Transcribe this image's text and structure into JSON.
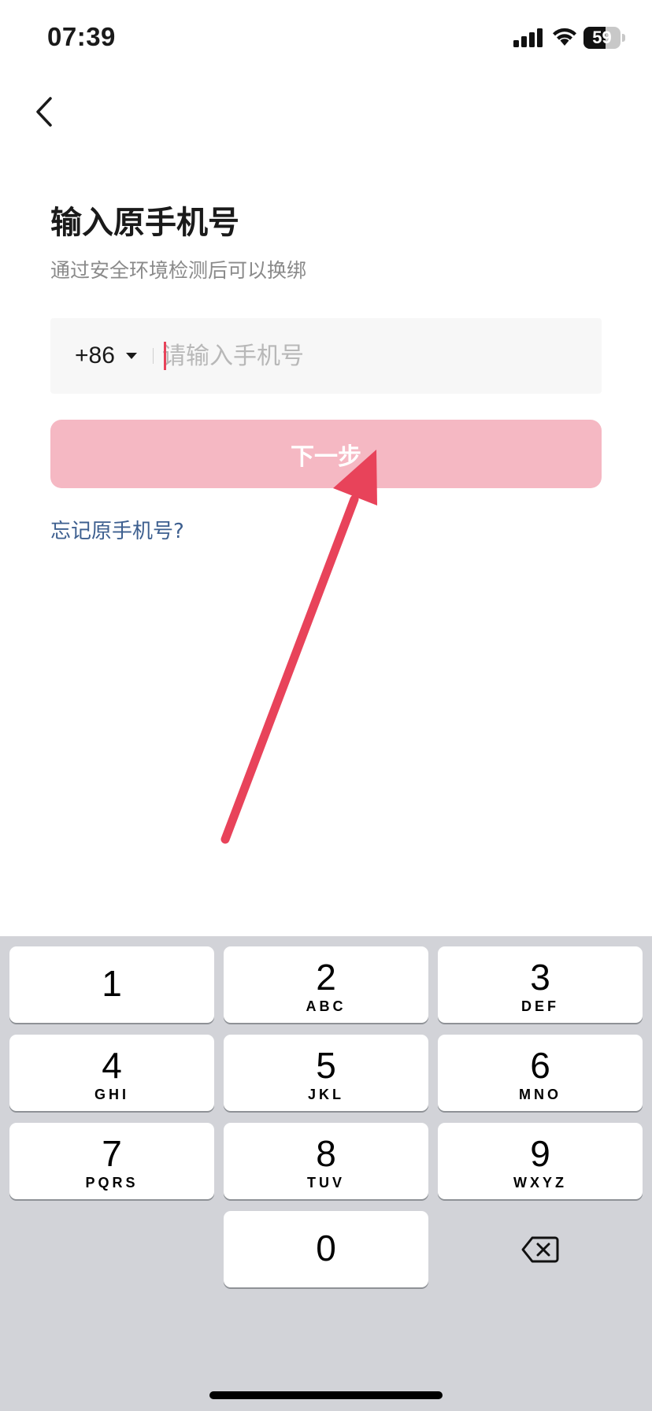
{
  "status_bar": {
    "time": "07:39",
    "battery_level": "59",
    "battery_fraction": 0.59
  },
  "header": {
    "back_icon": "chevron-left-icon"
  },
  "main": {
    "title": "输入原手机号",
    "subtitle": "通过安全环境检测后可以换绑",
    "phone_field": {
      "country_code": "+86",
      "placeholder": "请输入手机号",
      "value": ""
    },
    "next_button_label": "下一步",
    "forgot_link": "忘记原手机号?"
  },
  "keyboard": {
    "keys": [
      {
        "digit": "1",
        "letters": ""
      },
      {
        "digit": "2",
        "letters": "ABC"
      },
      {
        "digit": "3",
        "letters": "DEF"
      },
      {
        "digit": "4",
        "letters": "GHI"
      },
      {
        "digit": "5",
        "letters": "JKL"
      },
      {
        "digit": "6",
        "letters": "MNO"
      },
      {
        "digit": "7",
        "letters": "PQRS"
      },
      {
        "digit": "8",
        "letters": "TUV"
      },
      {
        "digit": "9",
        "letters": "WXYZ"
      },
      {
        "digit": "0",
        "letters": ""
      }
    ],
    "backspace_icon": "backspace-icon"
  },
  "colors": {
    "accent": "#e8435a",
    "button_disabled": "#f5b8c3",
    "link": "#3d5f8f",
    "keyboard_bg": "#d2d3d8"
  }
}
